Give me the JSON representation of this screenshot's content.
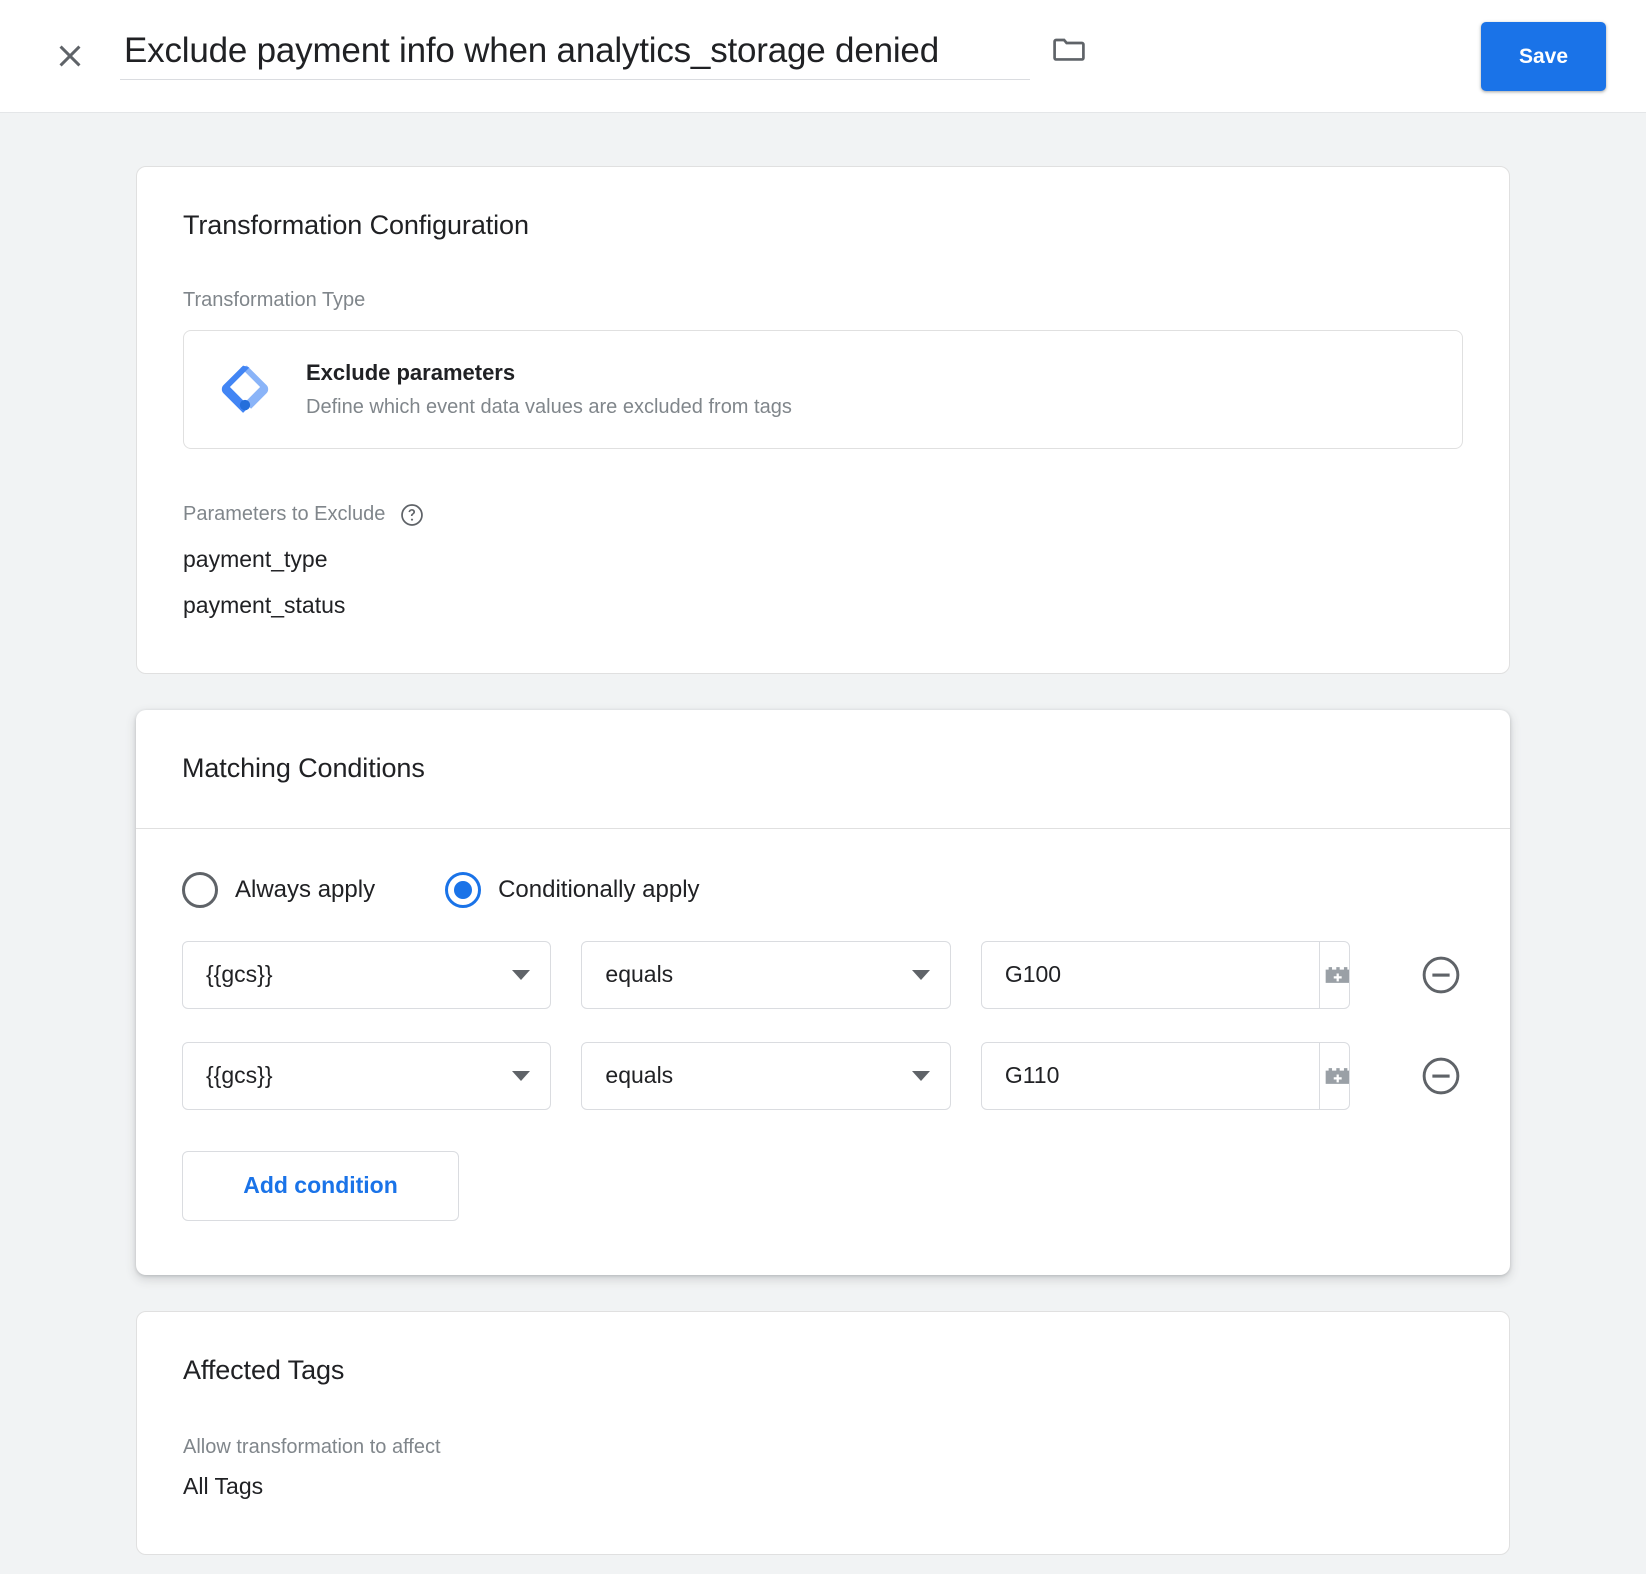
{
  "header": {
    "close_icon": "close-icon",
    "title_value": "Exclude payment info when analytics_storage denied",
    "title_placeholder": "Untitled Transformation",
    "folder_icon": "folder-icon",
    "save_label": "Save"
  },
  "transformation_card": {
    "title": "Transformation Configuration",
    "type_label": "Transformation Type",
    "type_icon": "google-tag-manager-logo-icon",
    "type_name": "Exclude parameters",
    "type_description": "Define which event data values are excluded from tags",
    "params_label": "Parameters to Exclude",
    "help_icon": "help-icon",
    "params": [
      "payment_type",
      "payment_status"
    ]
  },
  "matching_conditions_card": {
    "title": "Matching Conditions",
    "radio_options": [
      {
        "label": "Always apply",
        "selected": false
      },
      {
        "label": "Conditionally apply",
        "selected": true
      }
    ],
    "conditions": [
      {
        "variable": "{{gcs}}",
        "operator": "equals",
        "value": "G100",
        "value_placeholder": "",
        "variable_picker_icon": "variable-brick-icon",
        "remove_icon": "remove-circle-icon"
      },
      {
        "variable": "{{gcs}}",
        "operator": "equals",
        "value": "G110",
        "value_placeholder": "",
        "variable_picker_icon": "variable-brick-icon",
        "remove_icon": "remove-circle-icon"
      }
    ],
    "add_condition_label": "Add condition"
  },
  "affected_tags_card": {
    "title": "Affected Tags",
    "sub_label": "Allow transformation to affect",
    "value": "All Tags"
  },
  "colors": {
    "accent": "#1a73e8",
    "page_background": "#f1f3f4",
    "card_background": "#ffffff",
    "muted_text": "#80868b",
    "icon_gray": "#5f6368"
  }
}
